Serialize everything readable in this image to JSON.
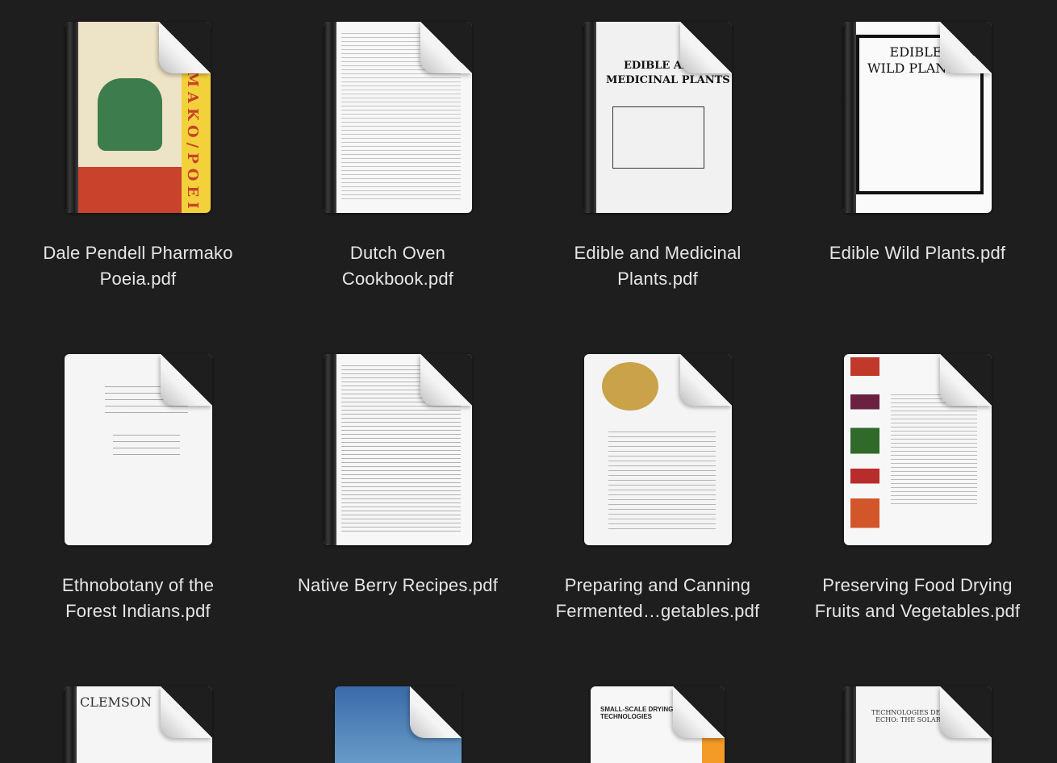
{
  "files": [
    {
      "name_lines": [
        "Dale Pendell Pharmako",
        "Poeia.pdf"
      ]
    },
    {
      "name_lines": [
        "Dutch Oven",
        "Cookbook.pdf"
      ]
    },
    {
      "name_lines": [
        "Edible and Medicinal",
        "Plants.pdf"
      ]
    },
    {
      "name_lines": [
        "Edible Wild Plants.pdf"
      ]
    },
    {
      "name_lines": [
        "Ethnobotany of the",
        "Forest Indians.pdf"
      ]
    },
    {
      "name_lines": [
        "Native Berry Recipes.pdf"
      ]
    },
    {
      "name_lines": [
        "Preparing and Canning",
        "Fermented…getables.pdf"
      ]
    },
    {
      "name_lines": [
        "Preserving Food Drying",
        "Fruits and Vegetables.pdf"
      ]
    }
  ],
  "covers": {
    "pharmako_vert": "RMAKO/POEIA",
    "edible_title_1": "EDIBLE AN",
    "edible_title_2": "MEDICINAL PLANTS",
    "wild_title_1": "EDIBLE",
    "wild_title_2": "WILD PLANTS",
    "clemson": "CLEMSON",
    "small_scale": "SMALL-SCALE DRYING TECHNOLOGIES",
    "echo": "TECHNOLOGIES DEMONST ECHO: THE SOLAR DEHY"
  },
  "colors": {
    "background": "#1e1e1e",
    "label_text": "#e6e6e6"
  }
}
